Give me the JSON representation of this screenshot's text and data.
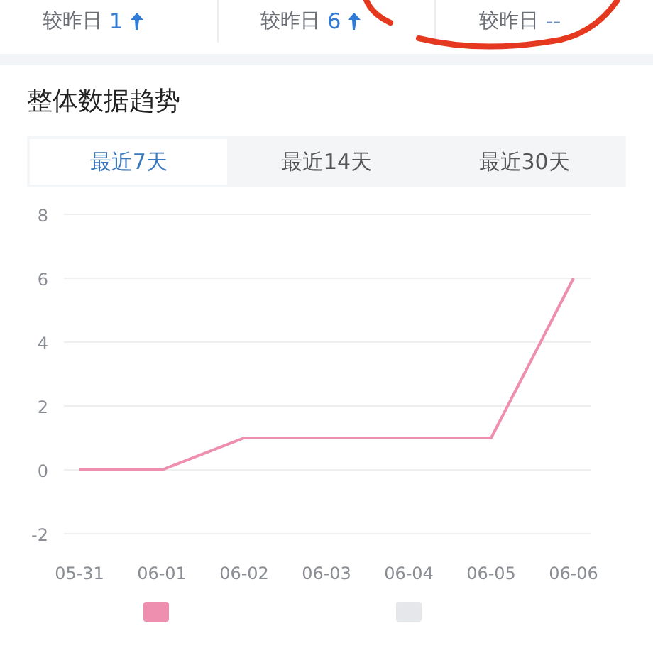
{
  "stats": [
    {
      "label": "较昨日",
      "value": "1",
      "rising": true
    },
    {
      "label": "较昨日",
      "value": "6",
      "rising": true
    },
    {
      "label": "较昨日",
      "value": "--",
      "rising": false
    }
  ],
  "section": {
    "title": "整体数据趋势"
  },
  "tabs": [
    {
      "label": "最近7天",
      "selected": true
    },
    {
      "label": "最近14天",
      "selected": false
    },
    {
      "label": "最近30天",
      "selected": false
    }
  ],
  "chart_data": {
    "type": "line",
    "categories": [
      "05-31",
      "06-01",
      "06-02",
      "06-03",
      "06-04",
      "06-05",
      "06-06"
    ],
    "series": [
      {
        "color": "#ee8fb0",
        "values": [
          0,
          0,
          1,
          1,
          1,
          1,
          6
        ]
      }
    ],
    "ylim": [
      -2,
      8
    ],
    "grid": true,
    "yticks": [
      -2,
      0,
      2,
      4,
      6,
      8
    ]
  },
  "legend": [
    {
      "color": "#ee8fb0"
    },
    {
      "color": "#e6e7ea"
    }
  ]
}
